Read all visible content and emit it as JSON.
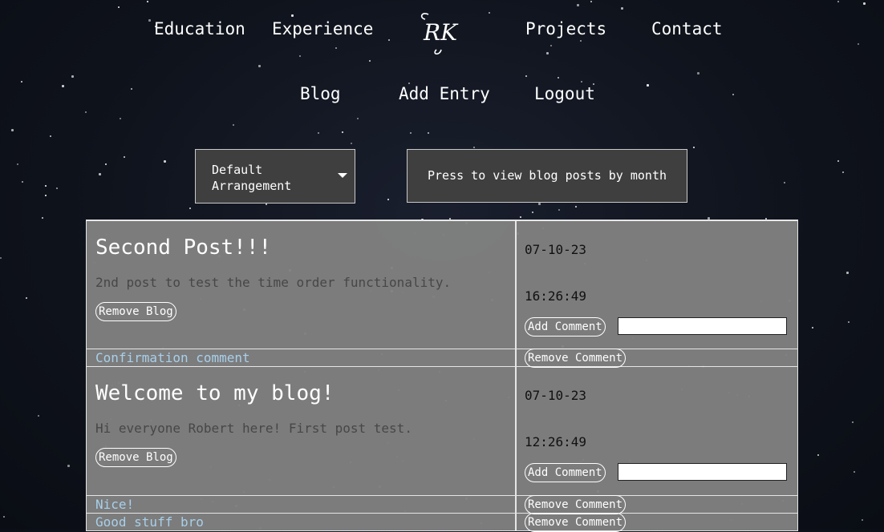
{
  "nav": {
    "row1": [
      "Education",
      "Experience",
      "Projects",
      "Contact"
    ],
    "row2": [
      "Blog",
      "Add Entry",
      "Logout"
    ],
    "logo_text": "RK"
  },
  "controls": {
    "arrangement_line1": "Default",
    "arrangement_line2": "Arrangement",
    "month_button": "Press to view blog posts by month"
  },
  "posts": [
    {
      "title": "Second Post!!!",
      "body": "2nd post to test the time order functionality.",
      "date": "07-10-23",
      "time": "16:26:49",
      "remove_label": "Remove Blog",
      "add_comment_label": "Add Comment",
      "comments": [
        {
          "text": "Confirmation comment",
          "remove_label": "Remove Comment"
        }
      ]
    },
    {
      "title": "Welcome to my blog!",
      "body": "Hi everyone Robert here! First post test.",
      "date": "07-10-23",
      "time": "12:26:49",
      "remove_label": "Remove Blog",
      "add_comment_label": "Add Comment",
      "comments": [
        {
          "text": "Nice!",
          "remove_label": "Remove Comment"
        },
        {
          "text": "Good stuff bro",
          "remove_label": "Remove Comment"
        }
      ]
    }
  ],
  "colors": {
    "background": "#0f131c",
    "panel": "#808080",
    "comment_text": "#a8d0ea"
  }
}
